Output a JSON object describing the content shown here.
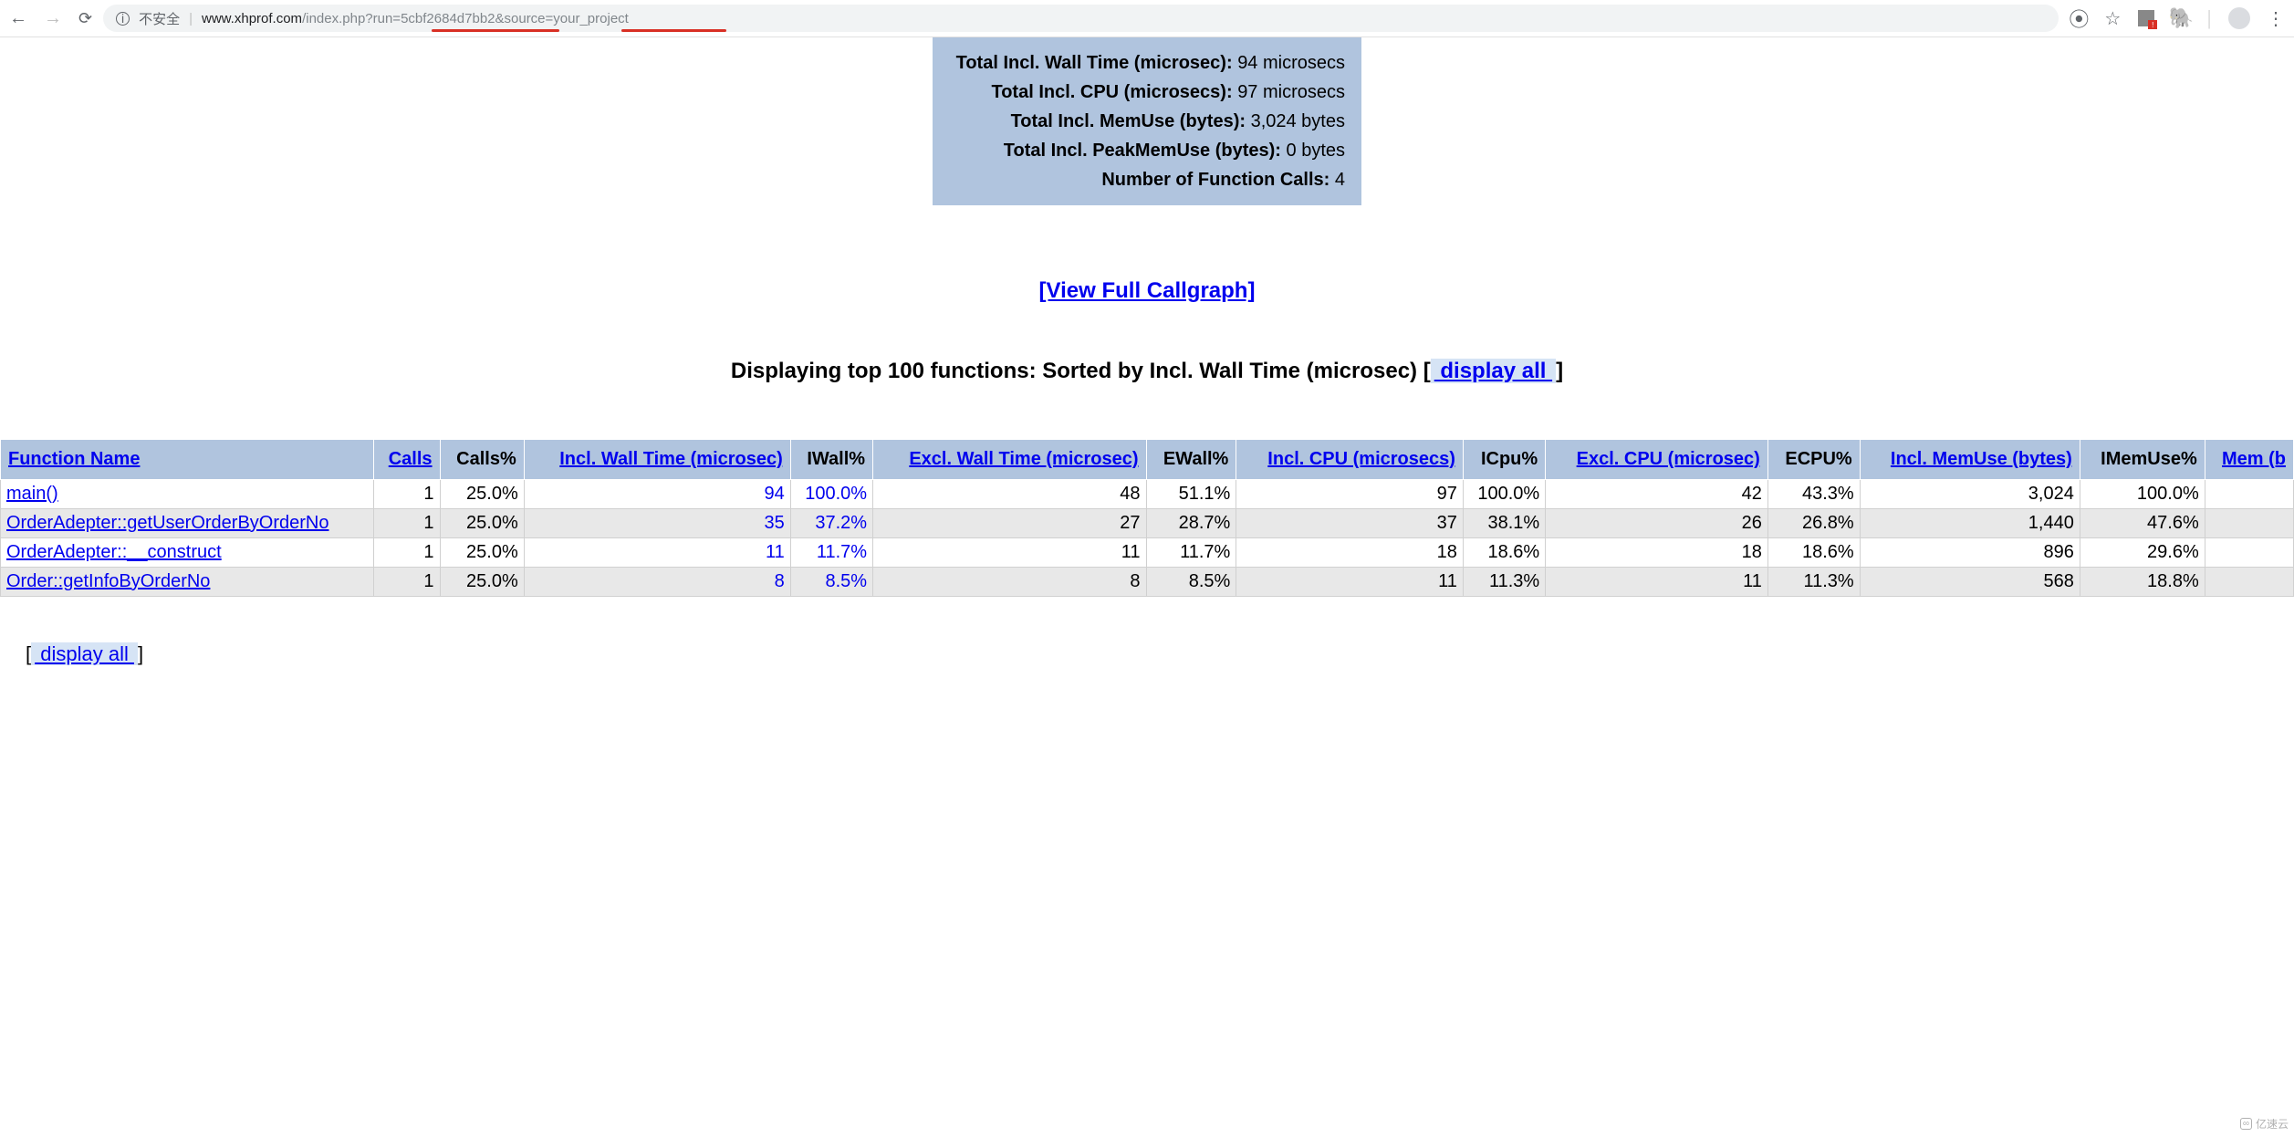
{
  "browser": {
    "insecure_label": "不安全",
    "url_host": "www.xhprof.com",
    "url_path": "/index.php?run=5cbf2684d7bb2&source=your_project"
  },
  "summary": {
    "rows": [
      {
        "label": "Total Incl. Wall Time (microsec):",
        "value": "94 microsecs"
      },
      {
        "label": "Total Incl. CPU (microsecs):",
        "value": "97 microsecs"
      },
      {
        "label": "Total Incl. MemUse (bytes):",
        "value": "3,024 bytes"
      },
      {
        "label": "Total Incl. PeakMemUse (bytes):",
        "value": "0 bytes"
      },
      {
        "label": "Number of Function Calls:",
        "value": "4"
      }
    ]
  },
  "callgraph_label": "[View Full Callgraph]",
  "heading_text": "Displaying top 100 functions: Sorted by Incl. Wall Time (microsec) ",
  "display_all_link": " display all ",
  "table": {
    "headers": [
      "Function Name",
      "Calls",
      "Calls%",
      "Incl. Wall Time (microsec)",
      "IWall%",
      "Excl. Wall Time (microsec)",
      "EWall%",
      "Incl. CPU (microsecs)",
      "ICpu%",
      "Excl. CPU (microsec)",
      "ECPU%",
      "Incl. MemUse (bytes)",
      "IMemUse%",
      "Mem (b"
    ],
    "rows": [
      {
        "fn": "main()",
        "cells": [
          "1",
          "25.0%",
          "94",
          "100.0%",
          "48",
          "51.1%",
          "97",
          "100.0%",
          "42",
          "43.3%",
          "3,024",
          "100.0%",
          ""
        ]
      },
      {
        "fn": "OrderAdepter::getUserOrderByOrderNo",
        "cells": [
          "1",
          "25.0%",
          "35",
          "37.2%",
          "27",
          "28.7%",
          "37",
          "38.1%",
          "26",
          "26.8%",
          "1,440",
          "47.6%",
          ""
        ]
      },
      {
        "fn": "OrderAdepter::__construct",
        "cells": [
          "1",
          "25.0%",
          "11",
          "11.7%",
          "11",
          "11.7%",
          "18",
          "18.6%",
          "18",
          "18.6%",
          "896",
          "29.6%",
          ""
        ]
      },
      {
        "fn": "Order::getInfoByOrderNo",
        "cells": [
          "1",
          "25.0%",
          "8",
          "8.5%",
          "8",
          "8.5%",
          "11",
          "11.3%",
          "11",
          "11.3%",
          "568",
          "18.8%",
          ""
        ]
      }
    ]
  },
  "watermark": "亿速云"
}
